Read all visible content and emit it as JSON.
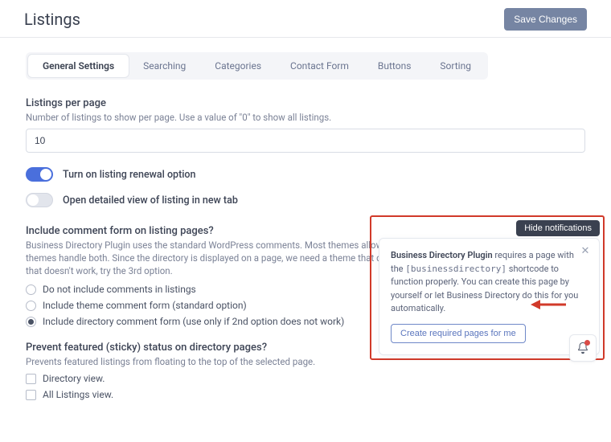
{
  "header": {
    "title": "Listings",
    "save_label": "Save Changes"
  },
  "tabs": [
    {
      "label": "General Settings",
      "active": true
    },
    {
      "label": "Searching",
      "active": false
    },
    {
      "label": "Categories",
      "active": false
    },
    {
      "label": "Contact Form",
      "active": false
    },
    {
      "label": "Buttons",
      "active": false
    },
    {
      "label": "Sorting",
      "active": false
    }
  ],
  "listings_per_page": {
    "label": "Listings per page",
    "help": "Number of listings to show per page. Use a value of \"0\" to show all listings.",
    "value": "10"
  },
  "toggles": {
    "renewal": {
      "label": "Turn on listing renewal option",
      "on": true
    },
    "new_tab": {
      "label": "Open detailed view of listing in new tab",
      "on": false
    }
  },
  "comment_form": {
    "label": "Include comment form on listing pages?",
    "help": "Business Directory Plugin uses the standard WordPress comments. Most themes allow for comments on posts, not pages. Some themes handle both. Since the directory is displayed on a page, we need a theme that can handle both. Use the 2nd option first, then if that doesn't work, try the 3rd option.",
    "options": [
      "Do not include comments in listings",
      "Include theme comment form (standard option)",
      "Include directory comment form (use only if 2nd option does not work)"
    ],
    "selected": 2
  },
  "sticky": {
    "label": "Prevent featured (sticky) status on directory pages?",
    "help": "Prevents featured listings from floating to the top of the selected page.",
    "options": [
      "Directory view.",
      "All Listings view."
    ]
  },
  "notification": {
    "hide_label": "Hide notifications",
    "strong": "Business Directory Plugin",
    "body1": " requires a page with the ",
    "code": "[businessdirectory]",
    "body2": " shortcode to function properly. You can create this page by yourself or let Business Directory do this for you automatically.",
    "action": "Create required pages for me"
  }
}
